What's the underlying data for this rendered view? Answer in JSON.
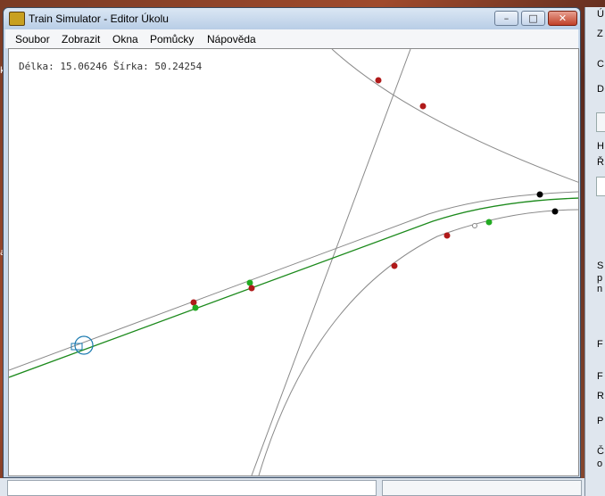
{
  "window": {
    "title": "Train Simulator - Editor Úkolu",
    "min_label": "–",
    "max_label": "□",
    "close_label": "✕"
  },
  "menu": {
    "items": [
      "Soubor",
      "Zobrazit",
      "Okna",
      "Pomůcky",
      "Nápověda"
    ]
  },
  "map": {
    "coords_text": "Délka: 15.06246 Šírka: 50.24254",
    "colors": {
      "track": "#8a8a8a",
      "route": "#1c8a1c",
      "marker_red": "#b01a1a",
      "marker_green": "#22aa22",
      "marker_black": "#000000",
      "player": "#1a7ab0"
    }
  },
  "right_panel": {
    "labels": [
      "Ú",
      "Z",
      "C",
      "D",
      "H",
      "Ř",
      "S",
      "p",
      "n",
      "F",
      "F",
      "R",
      "P",
      "Č",
      "o"
    ]
  },
  "desktop": {
    "edge_labels": [
      "k",
      "a"
    ]
  }
}
